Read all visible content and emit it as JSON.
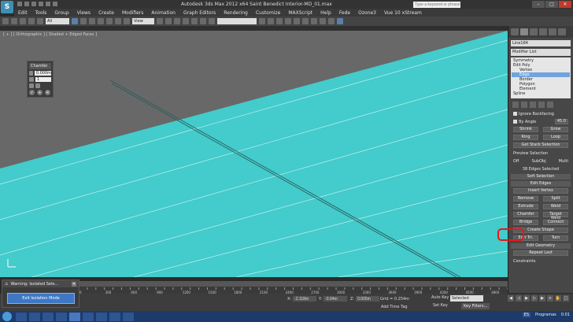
{
  "window": {
    "title": "Autodesk 3ds Max  2012 x64      Saint Benedict Interior-MD_01.max",
    "search_placeholder": "Type a keyword or phrase",
    "app_logo": "S"
  },
  "menu": [
    "Edit",
    "Tools",
    "Group",
    "Views",
    "Create",
    "Modifiers",
    "Animation",
    "Graph Editors",
    "Rendering",
    "Customize",
    "MAXScript",
    "Help",
    "Fede",
    "Ozone3",
    "Vue 10 xStream"
  ],
  "toolbar": {
    "selection_filter": "All",
    "ref_coord": "View"
  },
  "viewport": {
    "label": "[ + ] [ Orthographic ] [ Shaded + Edged Faces ]",
    "background_color": "#44cbcb"
  },
  "caddy": {
    "title": "Chamfer",
    "amount": "0.000m",
    "segments": "1"
  },
  "command_panel": {
    "object_name": "Line184",
    "modifier_list": "Modifier List",
    "stack": [
      {
        "label": "Symmetry",
        "level": 1
      },
      {
        "label": "Edit Poly",
        "level": 1
      },
      {
        "label": "Vertex",
        "level": 2
      },
      {
        "label": "Edge",
        "level": 2,
        "selected": true
      },
      {
        "label": "Border",
        "level": 2
      },
      {
        "label": "Polygon",
        "level": 2
      },
      {
        "label": "Element",
        "level": 2
      },
      {
        "label": "Spline",
        "level": 1
      }
    ],
    "ignore_backfacing": "Ignore Backfacing",
    "by_angle": "By Angle",
    "by_angle_value": "45.0",
    "shrink": "Shrink",
    "grow": "Grow",
    "ring": "Ring",
    "loop": "Loop",
    "get_stack_selection": "Get Stack Selection",
    "preview_selection": "Preview Selection",
    "preview_off": "Off",
    "preview_subobj": "SubObj",
    "preview_multi": "Multi",
    "edges_selected": "38 Edges Selected",
    "soft_selection": "Soft Selection",
    "edit_edges": "Edit Edges",
    "insert_vertex": "Insert Vertex",
    "remove": "Remove",
    "split": "Split",
    "extrude": "Extrude",
    "weld": "Weld",
    "chamfer": "Chamfer",
    "target_weld": "Target Weld",
    "bridge": "Bridge",
    "connect": "Connect",
    "create_shape": "Create Shape",
    "edit_tri": "Edit Tri.",
    "turn": "Turn",
    "edit_geometry": "Edit Geometry",
    "repeat_last": "Repeat Last",
    "constraints": "Constraints"
  },
  "timeline": {
    "ticks": [
      "0",
      "100",
      "200",
      "300",
      "400",
      "500",
      "600",
      "700",
      "800",
      "900",
      "1000",
      "1100",
      "1200",
      "1300",
      "1400",
      "1500",
      "1600",
      "1700",
      "1800",
      "1900",
      "2000",
      "2100",
      "2200",
      "2300",
      "2400",
      "2500",
      "2600",
      "2700",
      "2800",
      "2900",
      "3000",
      "3100",
      "3200",
      "3300",
      "3400",
      "3500",
      "3600",
      "3700",
      "3800",
      "3900",
      "4000",
      "4100",
      "4200",
      "4300",
      "4400",
      "4500",
      "4600",
      "4700",
      "4800",
      "4900",
      "5000"
    ]
  },
  "status": {
    "prompt": "to select objects",
    "x": "X:",
    "y": "Y:",
    "z": "Z:",
    "x_val": "-2.118m",
    "y_val": "-0.04m",
    "z_val": "0.005m",
    "grid": "Grid = 0.254m",
    "auto_key": "Auto Key",
    "selected": "Selected",
    "set_key": "Set Key",
    "key_filters": "Key Filters...",
    "add_time_tag": "Add Time Tag"
  },
  "warning": {
    "title": "Warning: Isolated Sele...",
    "button": "Exit Isolation Mode"
  },
  "taskbar": {
    "language": "ES",
    "programs": "Programas",
    "clock": "0:01"
  }
}
